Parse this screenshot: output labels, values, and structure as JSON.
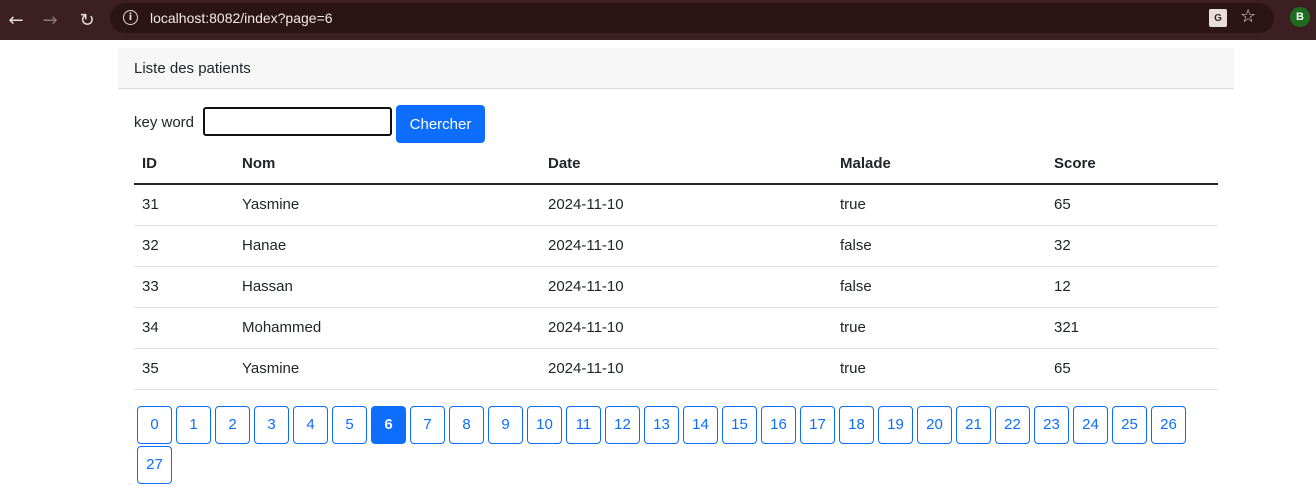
{
  "browser": {
    "url": "localhost:8082/index?page=6",
    "profile_initial": "B"
  },
  "card": {
    "title": "Liste des patients"
  },
  "search": {
    "label": "key word",
    "value": "",
    "button_label": "Chercher"
  },
  "table": {
    "headers": [
      "ID",
      "Nom",
      "Date",
      "Malade",
      "Score"
    ],
    "rows": [
      [
        "31",
        "Yasmine",
        "2024-11-10",
        "true",
        "65"
      ],
      [
        "32",
        "Hanae",
        "2024-11-10",
        "false",
        "32"
      ],
      [
        "33",
        "Hassan",
        "2024-11-10",
        "false",
        "12"
      ],
      [
        "34",
        "Mohammed",
        "2024-11-10",
        "true",
        "321"
      ],
      [
        "35",
        "Yasmine",
        "2024-11-10",
        "true",
        "65"
      ]
    ]
  },
  "pagination": {
    "pages": [
      "0",
      "1",
      "2",
      "3",
      "4",
      "5",
      "6",
      "7",
      "8",
      "9",
      "10",
      "11",
      "12",
      "13",
      "14",
      "15",
      "16",
      "17",
      "18",
      "19",
      "20",
      "21",
      "22",
      "23",
      "24",
      "25",
      "26",
      "27"
    ],
    "current": "6"
  },
  "colors": {
    "primary": "#0d6efd",
    "browser_bar": "#3b1f22"
  }
}
